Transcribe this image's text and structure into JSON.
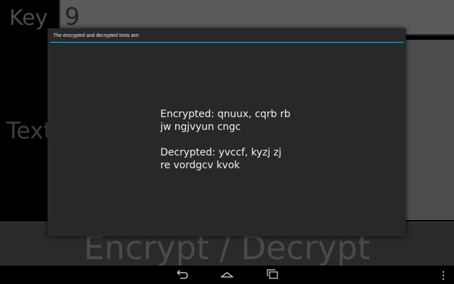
{
  "app": {
    "key_label": "Key",
    "key_value": "9",
    "text_label": "Text",
    "action_button": "Encrypt / Decrypt"
  },
  "dialog": {
    "title": "The encrypted and decrypted texts are:",
    "encrypted_line1": "Encrypted: qnuux, cqrb rb",
    "encrypted_line2": "jw ngjvyun cngc",
    "decrypted_line1": "Decrypted: yvccf, kyzj zj",
    "decrypted_line2": "re vordgcv kvok",
    "accent_color": "#33b5e5"
  },
  "navbar": {
    "icons": [
      "back-icon",
      "home-icon",
      "recent-apps-icon",
      "overflow-menu-icon"
    ]
  }
}
